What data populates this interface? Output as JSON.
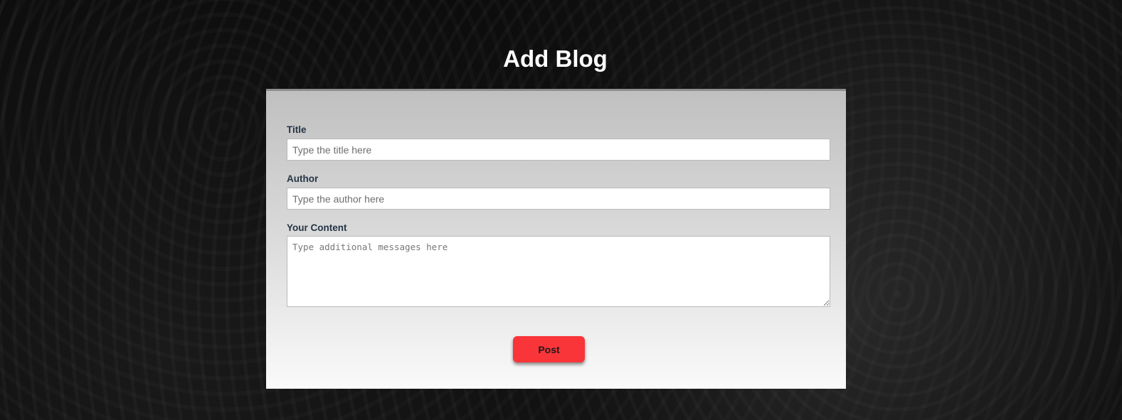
{
  "page": {
    "title": "Add Blog"
  },
  "form": {
    "title_label": "Title",
    "title_placeholder": "Type the title here",
    "author_label": "Author",
    "author_placeholder": "Type the author here",
    "content_label": "Your Content",
    "content_placeholder": "Type additional messages here",
    "submit_label": "Post"
  },
  "colors": {
    "submit_button": "#f9353a",
    "label_text": "#253445",
    "page_background": "#0b0b0b"
  }
}
